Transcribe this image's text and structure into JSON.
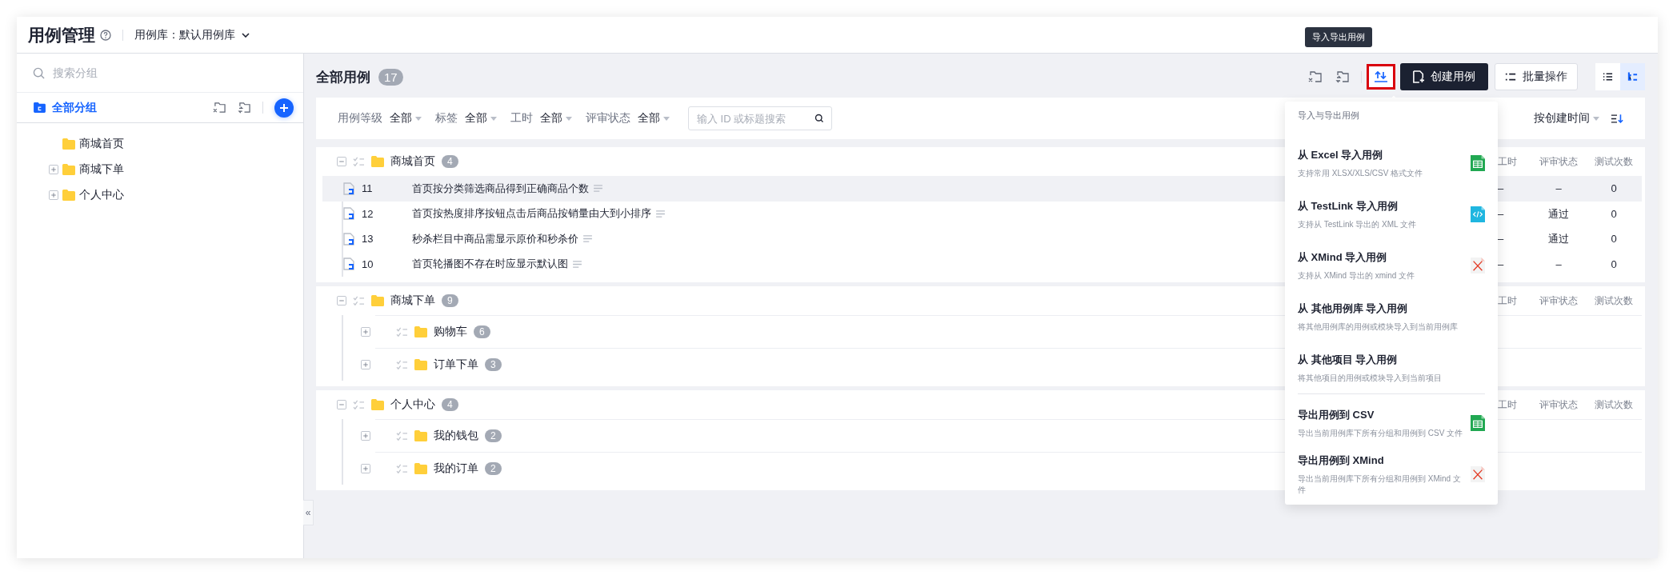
{
  "header": {
    "title": "用例管理",
    "library_label": "用例库：",
    "library": "默认用例库"
  },
  "sidebar": {
    "search": {
      "placeholder": "搜索分组"
    },
    "root": {
      "label": "全部分组",
      "selected": true
    },
    "tree": [
      {
        "label": "商城首页",
        "expandable": false
      },
      {
        "label": "商城下单",
        "expandable": true
      },
      {
        "label": "个人中心",
        "expandable": true
      }
    ]
  },
  "main": {
    "title": "全部用例",
    "count": "17",
    "tooltip": "导入导出用例",
    "import_highlighted": true,
    "create_button": "创建用例",
    "batch_button": "批量操作",
    "view_toggle": [
      {
        "kind": "list",
        "selected": false
      },
      {
        "kind": "tree",
        "selected": true
      }
    ],
    "filters": [
      {
        "label": "用例等级",
        "value": "全部"
      },
      {
        "label": "标签",
        "value": "全部"
      },
      {
        "label": "工时",
        "value": "全部"
      },
      {
        "label": "评审状态",
        "value": "全部"
      }
    ],
    "search": {
      "placeholder": "输入 ID 或标题搜索"
    },
    "sort": "按创建时间"
  },
  "groups": [
    {
      "name": "商城首页",
      "count": "4",
      "expanded": true,
      "columns": [
        "工时",
        "评审状态",
        "测试次数"
      ],
      "cases": [
        {
          "id": "11",
          "title": "首页按分类筛选商品得到正确商品个数",
          "hours": "–",
          "review": "–",
          "runs": "0",
          "selected": true
        },
        {
          "id": "12",
          "title": "首页按热度排序按钮点击后商品按销量由大到小排序",
          "hours": "–",
          "review": "通过",
          "runs": "0",
          "selected": false
        },
        {
          "id": "13",
          "title": "秒杀栏目中商品需显示原价和秒杀价",
          "hours": "–",
          "review": "通过",
          "runs": "0",
          "selected": false
        },
        {
          "id": "10",
          "title": "首页轮播图不存在时应显示默认图",
          "hours": "–",
          "review": "–",
          "runs": "0",
          "selected": false
        }
      ]
    },
    {
      "name": "商城下单",
      "count": "9",
      "expanded": true,
      "columns": [
        "工时",
        "评审状态",
        "测试次数"
      ],
      "children": [
        {
          "name": "购物车",
          "count": "6",
          "expanded": false
        },
        {
          "name": "订单下单",
          "count": "3",
          "expanded": false
        }
      ]
    },
    {
      "name": "个人中心",
      "count": "4",
      "expanded": true,
      "columns": [
        "工时",
        "评审状态",
        "测试次数"
      ],
      "children": [
        {
          "name": "我的钱包",
          "count": "2",
          "expanded": false
        },
        {
          "name": "我的订单",
          "count": "2",
          "expanded": false
        }
      ]
    }
  ],
  "collapse_handle": "«",
  "dropdown": {
    "title": "导入与导出用例",
    "import_items": [
      {
        "kind": "sheet",
        "title": "从 Excel 导入用例",
        "description": "支持常用 XLSX/XLS/CSV 格式文件"
      },
      {
        "kind": "code",
        "title": "从 TestLink 导入用例",
        "description": "支持从 TestLink 导出的 XML 文件"
      },
      {
        "kind": "xmind",
        "title": "从 XMind 导入用例",
        "description": "支持从 XMind 导出的 xmind 文件"
      },
      {
        "kind": "plain",
        "title": "从 其他用例库 导入用例",
        "description": "将其他用例库的用例或模块导入到当前用例库"
      },
      {
        "kind": "plain",
        "title": "从 其他项目 导入用例",
        "description": "将其他项目的用例或模块导入到当前项目"
      }
    ],
    "export_items": [
      {
        "kind": "sheet",
        "title": "导出用例到 CSV",
        "description": "导出当前用例库下所有分组和用例到 CSV 文件"
      },
      {
        "kind": "xmind",
        "title": "导出用例到 XMind",
        "description": "导出当前用例库下所有分组和用例到 XMind 文件"
      }
    ]
  }
}
